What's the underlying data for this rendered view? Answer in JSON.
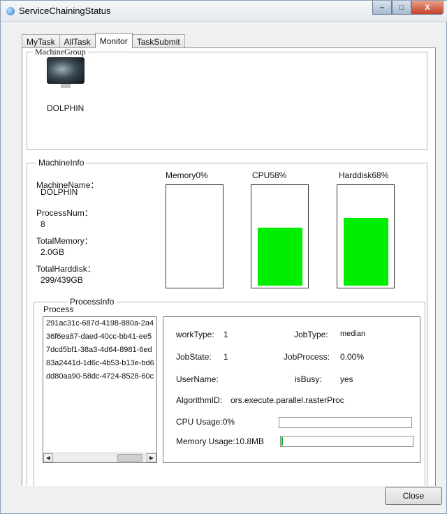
{
  "window": {
    "title": "ServiceChainingStatus",
    "controls": {
      "minimize": "–",
      "maximize": "□",
      "close": "X"
    }
  },
  "tabs": [
    {
      "label": "MyTask"
    },
    {
      "label": "AllTask"
    },
    {
      "label": "Monitor",
      "active": true
    },
    {
      "label": "TaskSubmit"
    }
  ],
  "machine_group": {
    "legend": "MachineGroup",
    "machine": {
      "name": "DOLPHIN",
      "icon": "monitor-icon"
    }
  },
  "machine_info": {
    "legend": "MachineInfo",
    "fields": [
      {
        "label": "MachineName：",
        "value": "DOLPHIN"
      },
      {
        "label": "ProcessNum：",
        "value": "8"
      },
      {
        "label": "TotalMemory：",
        "value": "2.0GB"
      },
      {
        "label": "TotalHarddisk：",
        "value": "299/439GB"
      }
    ],
    "gauges": [
      {
        "title": "Memory0%",
        "percent": 0
      },
      {
        "title": "CPU58%",
        "percent": 58
      },
      {
        "title": "Harddisk68%",
        "percent": 68
      }
    ],
    "gauge_color": "#00ef00"
  },
  "process_info": {
    "legend": "ProcessInfo",
    "list_label": "Process",
    "processes": [
      "291ac31c-687d-4198-880a-2a4",
      "36f6ea87-daed-40cc-bb41-ee5",
      "7dcd5bf1-38a3-4d64-8981-6ed",
      "83a2441d-1d6c-4b53-b13e-bd6",
      "dd80aa90-58dc-4724-8528-60c"
    ],
    "details": {
      "work_type_label": "workType:",
      "work_type": "1",
      "job_type_label": "JobType:",
      "job_type": "median",
      "job_state_label": "JobState:",
      "job_state": "1",
      "job_process_label": "JobProcess:",
      "job_process": "0.00%",
      "user_name_label": "UserName:",
      "user_name": "",
      "is_busy_label": "isBusy:",
      "is_busy": "yes",
      "algorithm_label": "AlgorithmID:",
      "algorithm": "ors.execute.parallel.rasterProc",
      "cpu_usage_label": "CPU Usage:0%",
      "cpu_usage_percent": 0,
      "memory_usage_label": "Memory Usage:10.8MB",
      "memory_usage_percent": 1
    },
    "usage_color": "#06b025"
  },
  "footer": {
    "close_label": "Close"
  }
}
